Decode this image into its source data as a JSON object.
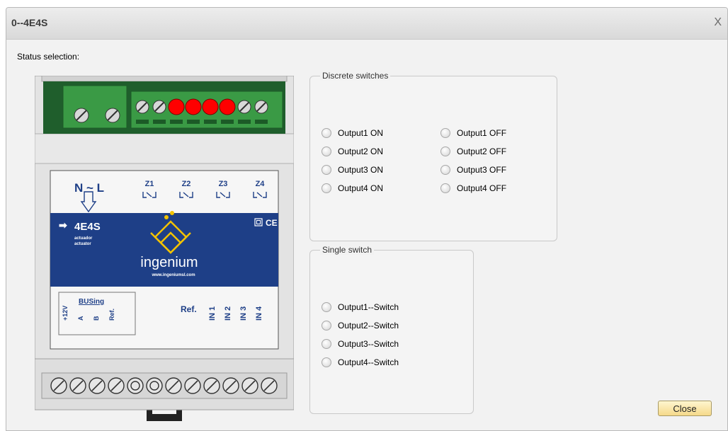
{
  "window": {
    "title": "0--4E4S",
    "close_glyph": "X"
  },
  "status_label": "Status selection:",
  "device": {
    "supply_label": "N ~ L",
    "zones": [
      "Z1",
      "Z2",
      "Z3",
      "Z4"
    ],
    "model": "4E4S",
    "subtitle_es": "actuador",
    "subtitle_en": "actuator",
    "brand": "ingenium",
    "url": "www.ingeniumsl.com",
    "ce_mark": "CE",
    "bus_logo": "BUSing",
    "bus_pins": [
      "+12V",
      "A",
      "B",
      "Ref."
    ],
    "ref_label": "Ref.",
    "inputs": [
      "IN 1",
      "IN 2",
      "IN 3",
      "IN 4"
    ],
    "output_leds": [
      "on",
      "on",
      "on",
      "on"
    ],
    "colors": {
      "body": "#e3e3e3",
      "label_blue": "#1e3f87",
      "terminal_green": "#2e8b3a",
      "led_red": "#ff0000",
      "logo_yellow": "#f2c200"
    }
  },
  "discrete": {
    "legend": "Discrete switches",
    "on_options": [
      "Output1 ON",
      "Output2 ON",
      "Output3 ON",
      "Output4 ON"
    ],
    "off_options": [
      "Output1 OFF",
      "Output2 OFF",
      "Output3 OFF",
      "Output4 OFF"
    ]
  },
  "single": {
    "legend": "Single switch",
    "options": [
      "Output1--Switch",
      "Output2--Switch",
      "Output3--Switch",
      "Output4--Switch"
    ]
  },
  "close_label": "Close"
}
